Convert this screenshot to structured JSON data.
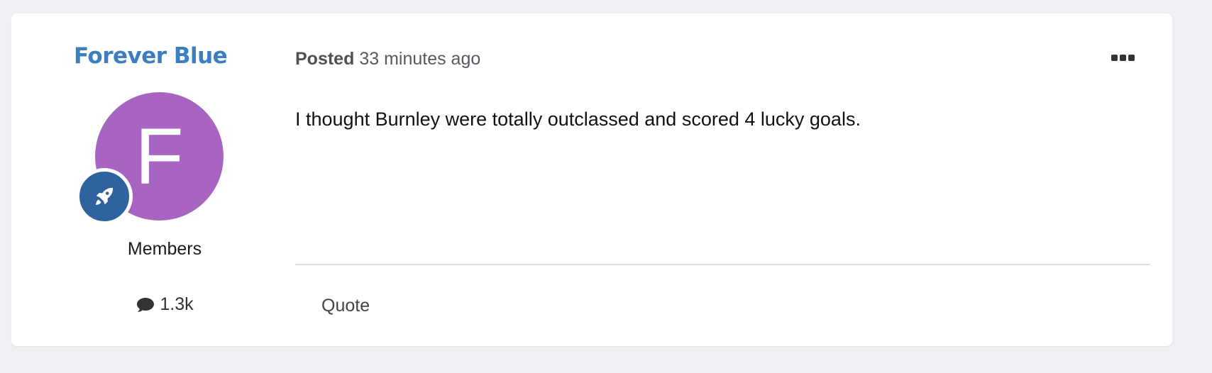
{
  "post": {
    "author": {
      "name": "Forever Blue",
      "avatar_initial": "F",
      "avatar_color": "#a765c1",
      "rank_icon": "rocket-icon",
      "group": "Members",
      "post_count": "1.3k"
    },
    "meta": {
      "posted_label": "Posted",
      "time_ago": "33 minutes ago"
    },
    "body": "I thought Burnley were totally outclassed and scored 4 lucky goals.",
    "actions": {
      "quote_label": "Quote",
      "more_icon": "ellipsis-icon"
    }
  },
  "colors": {
    "author_link": "#3b7fc0",
    "rank_badge": "#2f639f",
    "page_background": "#eef0f4"
  }
}
